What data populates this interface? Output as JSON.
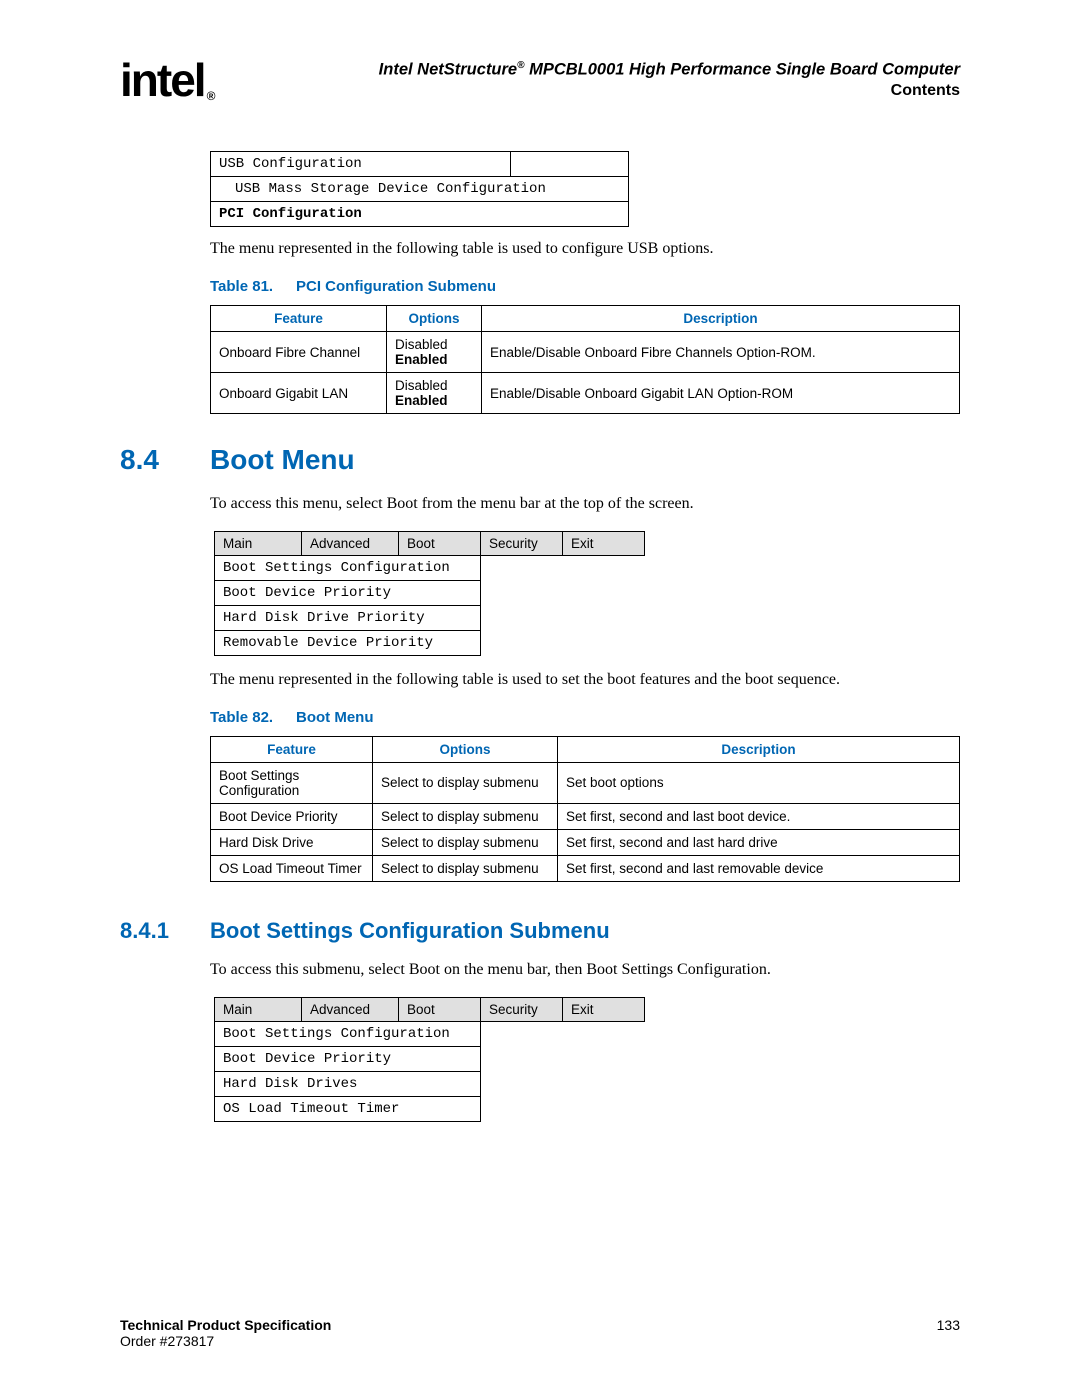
{
  "header": {
    "logo_text": "intel",
    "logo_reg": "®",
    "title_pre": "Intel NetStructure",
    "title_sup": "®",
    "title_post": " MPCBL0001 High Performance Single Board Computer",
    "contents": "Contents"
  },
  "mono1": {
    "r1": "USB Configuration",
    "r2": "USB Mass Storage Device Configuration",
    "r3": "PCI Configuration"
  },
  "para1": "The menu represented in the following table is used to configure USB options.",
  "table81": {
    "caption_label": "Table 81.",
    "caption_title": "PCI Configuration Submenu",
    "th_feature": "Feature",
    "th_options": "Options",
    "th_desc": "Description",
    "r1_feature": "Onboard Fibre Channel",
    "r1_opt1": "Disabled",
    "r1_opt2": "Enabled",
    "r1_desc": "Enable/Disable Onboard Fibre Channels Option-ROM.",
    "r2_feature": "Onboard Gigabit LAN",
    "r2_opt1": "Disabled",
    "r2_opt2": "Enabled",
    "r2_desc": "Enable/Disable Onboard Gigabit LAN Option-ROM"
  },
  "sec84": {
    "num": "8.4",
    "title": "Boot Menu"
  },
  "para2": "To access this menu, select Boot from the menu bar at the top of the screen.",
  "menu1": {
    "tab1": "Main",
    "tab2": "Advanced",
    "tab3": "Boot",
    "tab4": "Security",
    "tab5": "Exit",
    "i1": "Boot Settings Configuration",
    "i2": "Boot Device Priority",
    "i3": "Hard Disk Drive Priority",
    "i4": "Removable Device Priority"
  },
  "para3": "The menu represented in the following table is used to set the boot features and the boot sequence.",
  "table82": {
    "caption_label": "Table 82.",
    "caption_title": "Boot Menu",
    "th_feature": "Feature",
    "th_options": "Options",
    "th_desc": "Description",
    "r1_feature": "Boot Settings Configuration",
    "r1_opt": "Select to display submenu",
    "r1_desc": "Set boot options",
    "r2_feature": "Boot Device Priority",
    "r2_opt": "Select to display submenu",
    "r2_desc": "Set first, second and last boot device.",
    "r3_feature": "Hard Disk Drive",
    "r3_opt": "Select to display submenu",
    "r3_desc": "Set first, second and last hard drive",
    "r4_feature": "OS Load Timeout Timer",
    "r4_opt": "Select to display submenu",
    "r4_desc": "Set first, second and last removable device"
  },
  "sec841": {
    "num": "8.4.1",
    "title": "Boot Settings Configuration Submenu"
  },
  "para4": "To access this submenu, select Boot on the menu bar, then Boot Settings Configuration.",
  "menu2": {
    "tab1": "Main",
    "tab2": "Advanced",
    "tab3": "Boot",
    "tab4": "Security",
    "tab5": "Exit",
    "i1": "Boot Settings Configuration",
    "i2": "Boot Device Priority",
    "i3": "Hard Disk Drives",
    "i4": "OS Load Timeout Timer"
  },
  "footer": {
    "tps": "Technical Product Specification",
    "order": "Order #273817",
    "page": "133"
  }
}
